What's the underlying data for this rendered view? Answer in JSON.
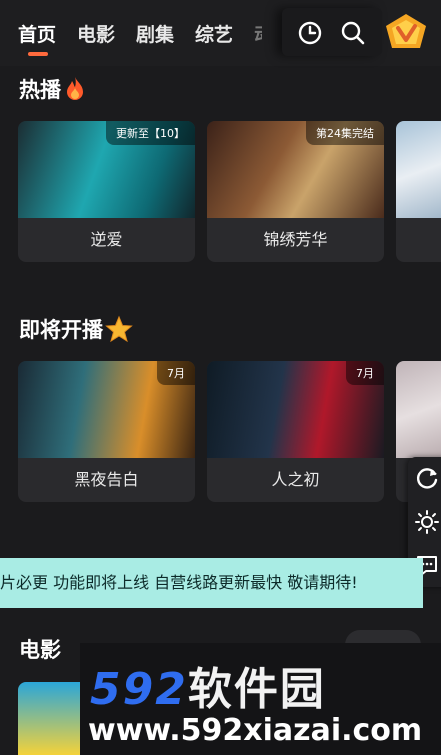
{
  "nav": {
    "tabs": [
      {
        "label": "首页",
        "active": true
      },
      {
        "label": "电影",
        "active": false
      },
      {
        "label": "剧集",
        "active": false
      },
      {
        "label": "综艺",
        "active": false
      },
      {
        "label": "动漫",
        "active": false
      }
    ],
    "icons": [
      "history-icon",
      "search-icon",
      "vip-logo"
    ],
    "accent_color": "#ff6a3d"
  },
  "sections": {
    "hot": {
      "title": "热播",
      "icon": "fire-icon",
      "items": [
        {
          "title": "逆爱",
          "badge": "更新至【10】"
        },
        {
          "title": "锦绣芳华",
          "badge": "第24集完结"
        },
        {
          "title": "",
          "badge": ""
        }
      ]
    },
    "soon": {
      "title": "即将开播",
      "icon": "star-icon",
      "items": [
        {
          "title": "黑夜告白",
          "badge": "7月"
        },
        {
          "title": "人之初",
          "badge": "7月"
        },
        {
          "title": "",
          "badge": ""
        }
      ]
    },
    "movie": {
      "title": "电影"
    }
  },
  "marquee": {
    "text": "片必更 功能即将上线 自营线路更新最快 敬请期待!",
    "bg_color": "#a9ece4"
  },
  "side_tools": [
    "refresh-icon",
    "brightness-icon",
    "feedback-icon"
  ],
  "watermark": {
    "brand_number": "592",
    "brand_text": "软件园",
    "url": "www.592xiazai.com"
  }
}
